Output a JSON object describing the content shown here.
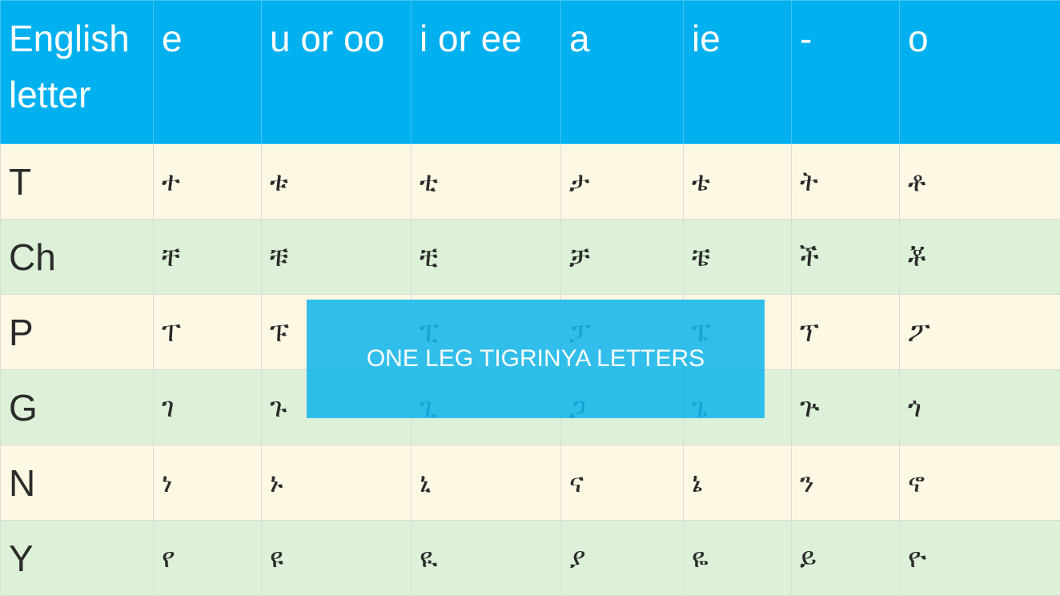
{
  "table": {
    "headers": [
      "English letter",
      "e",
      "u or oo",
      "i or ee",
      "a",
      "ie",
      "-",
      "o"
    ],
    "rows": [
      {
        "letter": "T",
        "forms": [
          "ተ",
          "ቱ",
          "ቲ",
          "ታ",
          "ቴ",
          "ት",
          "ቶ"
        ]
      },
      {
        "letter": "Ch",
        "forms": [
          "ቸ",
          "ቹ",
          "ቺ",
          "ቻ",
          "ቼ",
          "ች",
          "ቾ"
        ]
      },
      {
        "letter": "P",
        "forms": [
          "ፐ",
          "ፑ",
          "ፒ",
          "ፓ",
          "ፔ",
          "ፕ",
          "ፖ"
        ]
      },
      {
        "letter": "G",
        "forms": [
          "ገ",
          "ጉ",
          "ጊ",
          "ጋ",
          "ጌ",
          "ጕ",
          "ጎ"
        ]
      },
      {
        "letter": "N",
        "forms": [
          "ነ",
          "ኑ",
          "ኒ",
          "ና",
          "ኔ",
          "ን",
          "ኖ"
        ]
      },
      {
        "letter": "Y",
        "forms": [
          "የ",
          "ዩ",
          "ዪ",
          "ያ",
          "ዬ",
          "ይ",
          "ዮ"
        ]
      }
    ]
  },
  "banner": {
    "text": "ONE LEG TIGRINYA LETTERS"
  },
  "colors": {
    "header_bg": "#00b0ef",
    "row_odd_bg": "#fdf8e4",
    "row_even_bg": "#ddf0d8",
    "banner_bg": "#15b5eb"
  }
}
